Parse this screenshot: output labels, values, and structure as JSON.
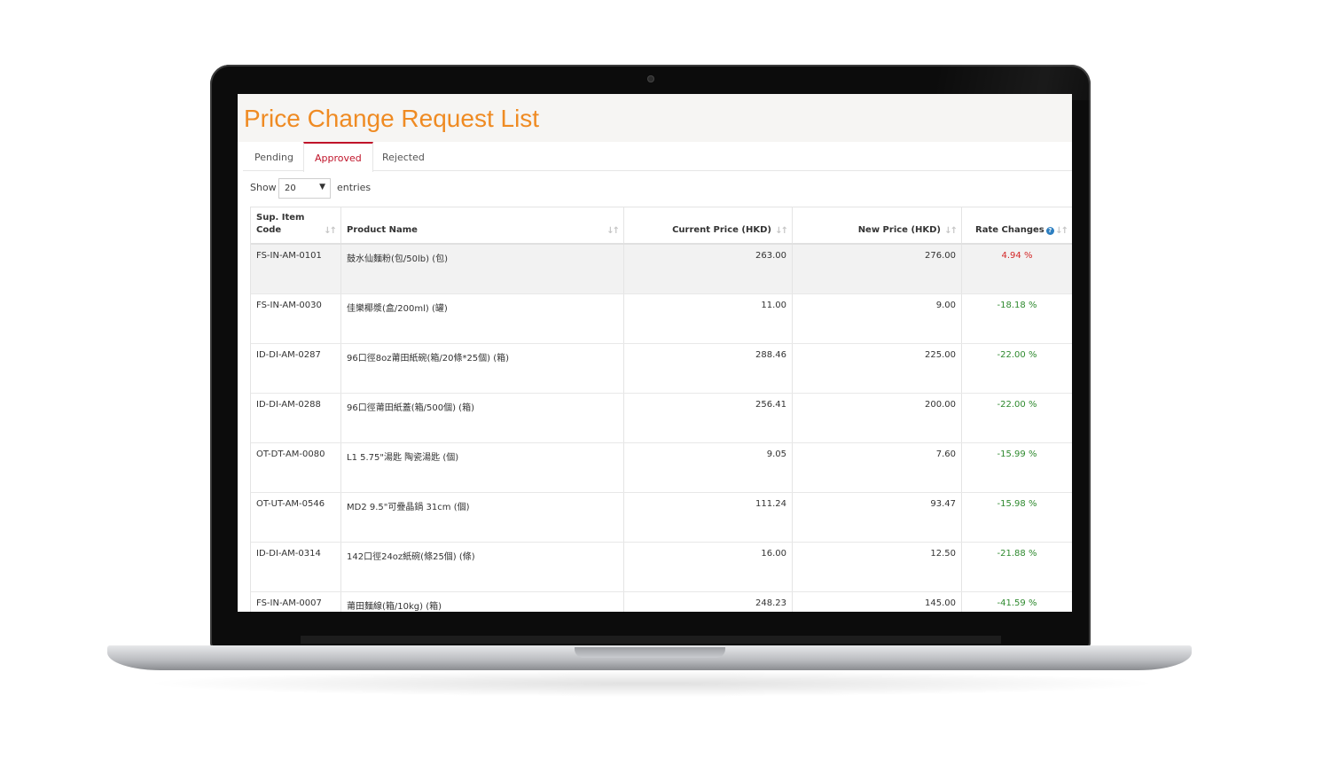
{
  "page": {
    "title": "Price Change Request List"
  },
  "tabs": [
    {
      "label": "Pending"
    },
    {
      "label": "Approved"
    },
    {
      "label": "Rejected"
    }
  ],
  "length_menu": {
    "show_label": "Show",
    "selected": "20",
    "entries_label": "entries"
  },
  "table": {
    "headers": {
      "code": "Sup. Item Code",
      "name": "Product Name",
      "current": "Current Price (HKD)",
      "new": "New Price (HKD)",
      "rate": "Rate Changes"
    },
    "rows": [
      {
        "code": "FS-IN-AM-0101",
        "name": "鼓水仙麵粉(包/50lb) (包)",
        "current": "263.00",
        "new": "276.00",
        "rate": "4.94 %"
      },
      {
        "code": "FS-IN-AM-0030",
        "name": "佳樂椰漿(盒/200ml) (罐)",
        "current": "11.00",
        "new": "9.00",
        "rate": "-18.18 %"
      },
      {
        "code": "ID-DI-AM-0287",
        "name": "96口徑8oz莆田紙碗(箱/20條*25個) (箱)",
        "current": "288.46",
        "new": "225.00",
        "rate": "-22.00 %"
      },
      {
        "code": "ID-DI-AM-0288",
        "name": "96口徑莆田紙蓋(箱/500個) (箱)",
        "current": "256.41",
        "new": "200.00",
        "rate": "-22.00 %"
      },
      {
        "code": "OT-DT-AM-0080",
        "name": "L1 5.75\"湯匙 陶瓷湯匙 (個)",
        "current": "9.05",
        "new": "7.60",
        "rate": "-15.99 %"
      },
      {
        "code": "OT-UT-AM-0546",
        "name": "MD2 9.5\"可疊晶鍋 31cm (個)",
        "current": "111.24",
        "new": "93.47",
        "rate": "-15.98 %"
      },
      {
        "code": "ID-DI-AM-0314",
        "name": "142口徑24oz紙碗(條25個) (條)",
        "current": "16.00",
        "new": "12.50",
        "rate": "-21.88 %"
      },
      {
        "code": "FS-IN-AM-0007",
        "name": "莆田麵線(箱/10kg) (箱)",
        "current": "248.23",
        "new": "145.00",
        "rate": "-41.59 %"
      }
    ]
  },
  "colors": {
    "title": "#ef8b23",
    "active_tab": "#c0142a",
    "negative_rate": "#2f8a2f",
    "positive_rate": "#d32626"
  }
}
